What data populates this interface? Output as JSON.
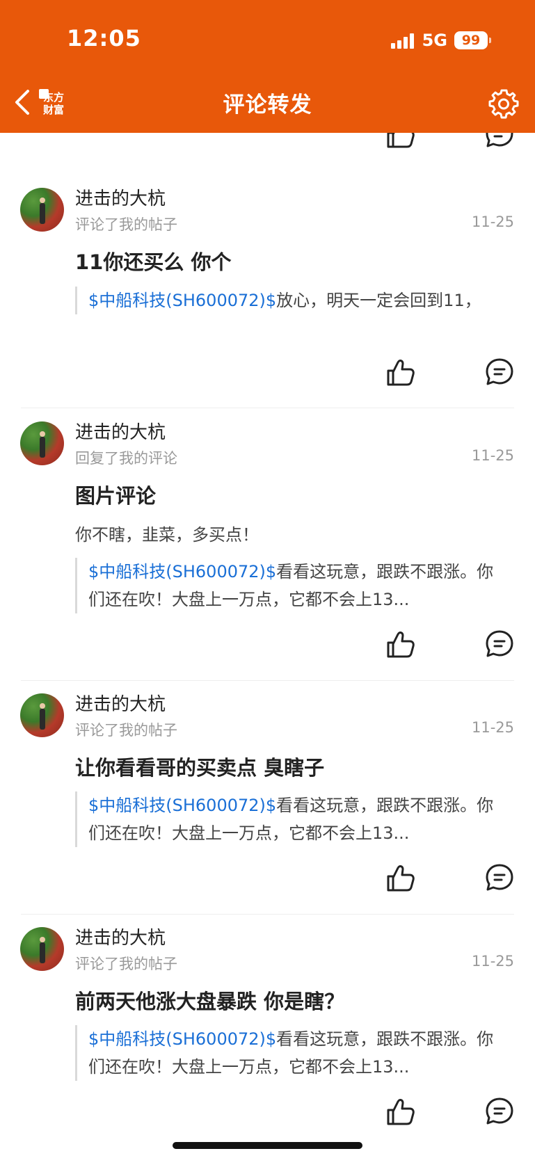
{
  "status_bar": {
    "time": "12:05",
    "network": "5G",
    "battery": "99"
  },
  "nav": {
    "title": "评论转发",
    "logo_line1": "东方",
    "logo_line2": "财富"
  },
  "items": [
    {
      "username": "进击的大杭",
      "action": "评论了我的帖子",
      "date": "11-25",
      "comment": "11你还买么 你个",
      "reply": "",
      "quote_stock": "$中船科技(SH600072)$",
      "quote_text": "放心，明天一定会回到11，"
    },
    {
      "username": "进击的大杭",
      "action": "回复了我的评论",
      "date": "11-25",
      "comment": "图片评论",
      "reply": "你不瞎，韭菜，多买点！",
      "quote_stock": "$中船科技(SH600072)$",
      "quote_text": "看看这玩意，跟跌不跟涨。你们还在吹！大盘上一万点，它都不会上13..."
    },
    {
      "username": "进击的大杭",
      "action": "评论了我的帖子",
      "date": "11-25",
      "comment": "让你看看哥的买卖点 臭瞎子",
      "reply": "",
      "quote_stock": "$中船科技(SH600072)$",
      "quote_text": "看看这玩意，跟跌不跟涨。你们还在吹！大盘上一万点，它都不会上13..."
    },
    {
      "username": "进击的大杭",
      "action": "评论了我的帖子",
      "date": "11-25",
      "comment": "前两天他涨大盘暴跌 你是瞎？",
      "reply": "",
      "quote_stock": "$中船科技(SH600072)$",
      "quote_text": "看看这玩意，跟跌不跟涨。你们还在吹！大盘上一万点，它都不会上13..."
    }
  ],
  "icons": {
    "back": "chevron-left-icon",
    "settings": "gear-icon",
    "like": "thumbs-up-icon",
    "comment": "chat-bubble-icon"
  },
  "colors": {
    "header_bg": "#e8580a",
    "stock_link": "#1a6fd6"
  }
}
